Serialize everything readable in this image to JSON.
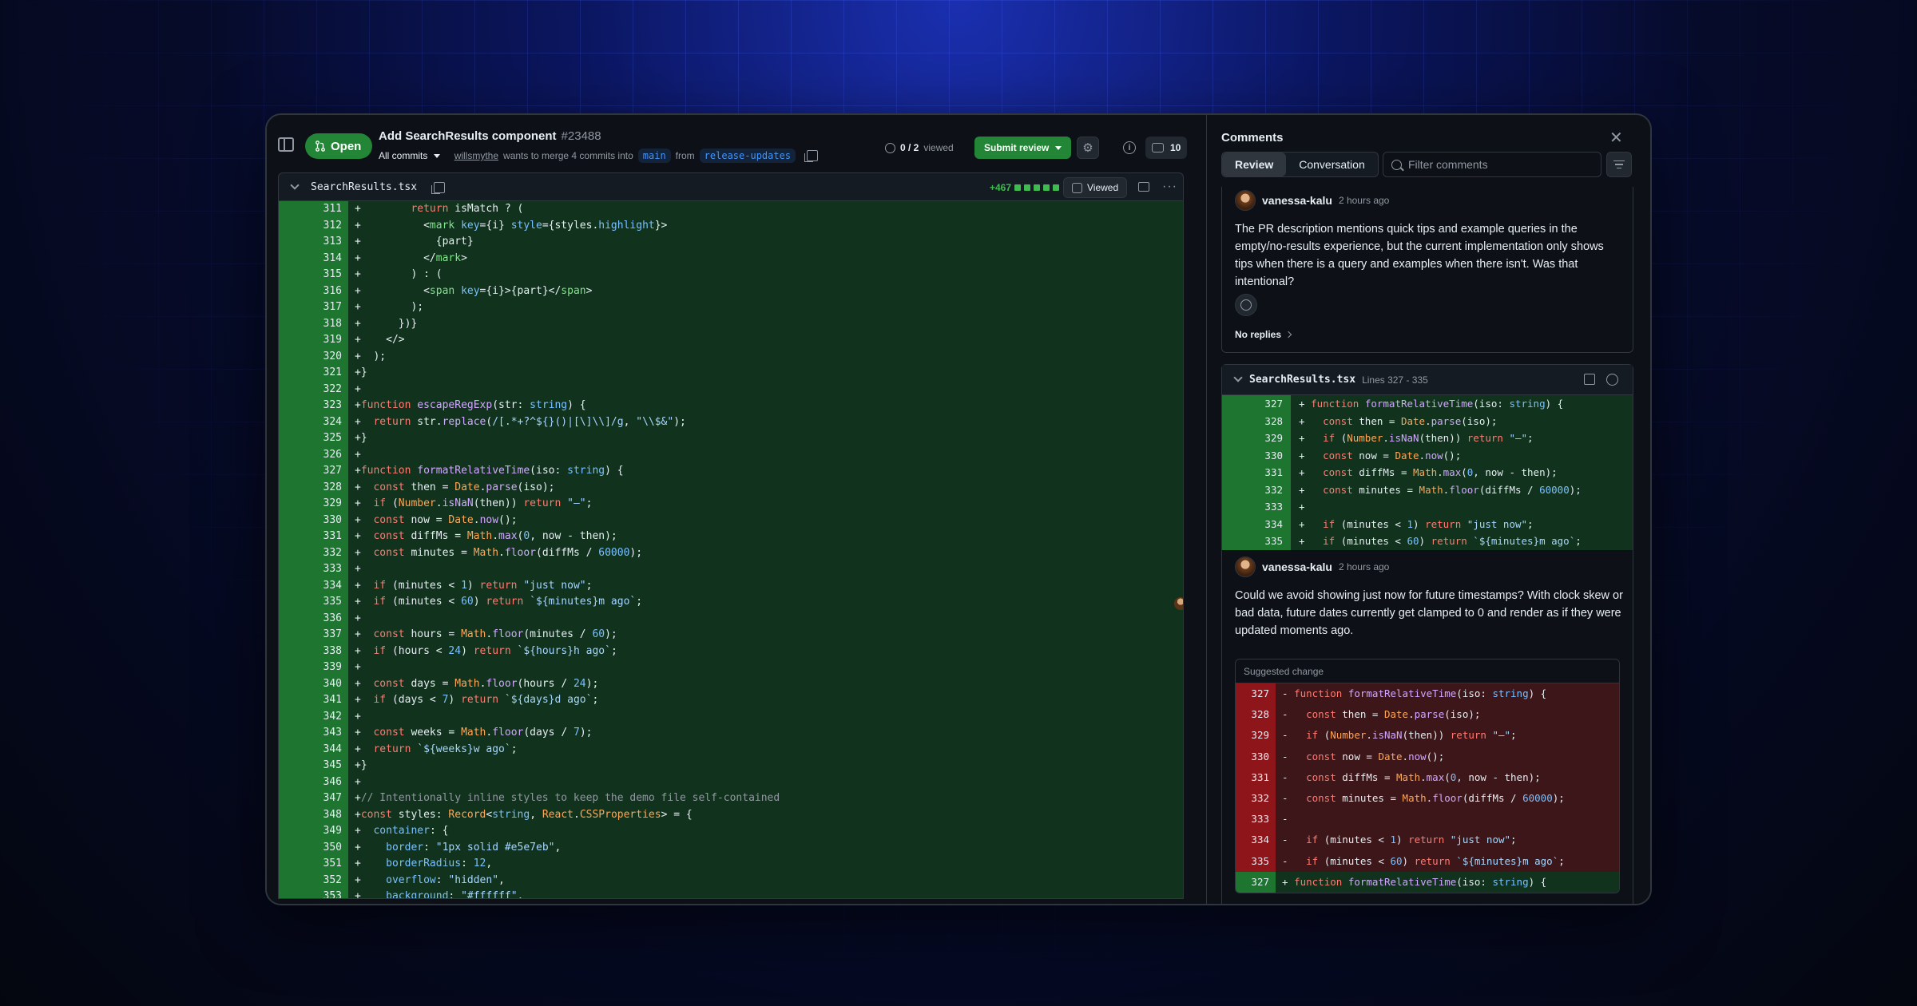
{
  "pr": {
    "status": "Open",
    "title": "Add SearchResults component",
    "number": "#23488",
    "commits_label": "All commits",
    "author": "willsmythe",
    "merge_text": "wants to merge 4 commits into",
    "base_branch": "main",
    "from_text": "from",
    "head_branch": "release-updates",
    "viewed_done": "0 / 2",
    "viewed_label": "viewed",
    "submit_label": "Submit review",
    "comment_count": "10"
  },
  "file": {
    "name": "SearchResults.tsx",
    "additions": "+467",
    "viewed_label": "Viewed"
  },
  "code_lines": [
    {
      "n": "311",
      "html": "+        <span class=\"k\">return</span> isMatch ? ("
    },
    {
      "n": "312",
      "html": "+          &lt;<span class=\"g\">mark</span> <span class=\"v\">key</span>={i} <span class=\"v\">style</span>={styles.<span class=\"v\">highlight</span>}&gt;"
    },
    {
      "n": "313",
      "html": "+            {part}"
    },
    {
      "n": "314",
      "html": "+          &lt;/<span class=\"g\">mark</span>&gt;"
    },
    {
      "n": "315",
      "html": "+        ) : ("
    },
    {
      "n": "316",
      "html": "+          &lt;<span class=\"g\">span</span> <span class=\"v\">key</span>={i}&gt;{part}&lt;/<span class=\"g\">span</span>&gt;"
    },
    {
      "n": "317",
      "html": "+        );"
    },
    {
      "n": "318",
      "html": "+      })}"
    },
    {
      "n": "319",
      "html": "+    &lt;/&gt;"
    },
    {
      "n": "320",
      "html": "+  );"
    },
    {
      "n": "321",
      "html": "+}"
    },
    {
      "n": "322",
      "html": "+"
    },
    {
      "n": "323",
      "html": "+<span class=\"k\">function</span> <span class=\"f\">escapeRegExp</span>(str: <span class=\"v\">string</span>) {"
    },
    {
      "n": "324",
      "html": "+  <span class=\"k\">return</span> str.<span class=\"f\">replace</span>(<span class=\"s\">/[.*+?^${}()|[\\]\\\\]/g</span>, <span class=\"s\">\"\\\\$&amp;\"</span>);"
    },
    {
      "n": "325",
      "html": "+}"
    },
    {
      "n": "326",
      "html": "+"
    },
    {
      "n": "327",
      "html": "+<span class=\"k\">function</span> <span class=\"f\">formatRelativeTime</span>(iso: <span class=\"v\">string</span>) {"
    },
    {
      "n": "328",
      "html": "+  <span class=\"k\">const</span> then = <span class=\"t\">Date</span>.<span class=\"f\">parse</span>(iso);"
    },
    {
      "n": "329",
      "html": "+  <span class=\"k\">if</span> (<span class=\"t\">Number</span>.<span class=\"f\">isNaN</span>(then)) <span class=\"k\">return</span> <span class=\"s\">\"—\"</span>;"
    },
    {
      "n": "330",
      "html": "+  <span class=\"k\">const</span> now = <span class=\"t\">Date</span>.<span class=\"f\">now</span>();"
    },
    {
      "n": "331",
      "html": "+  <span class=\"k\">const</span> diffMs = <span class=\"t\">Math</span>.<span class=\"f\">max</span>(<span class=\"v\">0</span>, now - then);"
    },
    {
      "n": "332",
      "html": "+  <span class=\"k\">const</span> minutes = <span class=\"t\">Math</span>.<span class=\"f\">floor</span>(diffMs / <span class=\"v\">60000</span>);"
    },
    {
      "n": "333",
      "html": "+"
    },
    {
      "n": "334",
      "html": "+  <span class=\"k\">if</span> (minutes &lt; <span class=\"v\">1</span>) <span class=\"k\">return</span> <span class=\"s\">\"just now\"</span>;"
    },
    {
      "n": "335",
      "html": "+  <span class=\"k\">if</span> (minutes &lt; <span class=\"v\">60</span>) <span class=\"k\">return</span> <span class=\"s\">`${minutes}m ago`</span>;",
      "comments": "1"
    },
    {
      "n": "336",
      "html": "+"
    },
    {
      "n": "337",
      "html": "+  <span class=\"k\">const</span> hours = <span class=\"t\">Math</span>.<span class=\"f\">floor</span>(minutes / <span class=\"v\">60</span>);"
    },
    {
      "n": "338",
      "html": "+  <span class=\"k\">if</span> (hours &lt; <span class=\"v\">24</span>) <span class=\"k\">return</span> <span class=\"s\">`${hours}h ago`</span>;"
    },
    {
      "n": "339",
      "html": "+"
    },
    {
      "n": "340",
      "html": "+  <span class=\"k\">const</span> days = <span class=\"t\">Math</span>.<span class=\"f\">floor</span>(hours / <span class=\"v\">24</span>);"
    },
    {
      "n": "341",
      "html": "+  <span class=\"k\">if</span> (days &lt; <span class=\"v\">7</span>) <span class=\"k\">return</span> <span class=\"s\">`${days}d ago`</span>;"
    },
    {
      "n": "342",
      "html": "+"
    },
    {
      "n": "343",
      "html": "+  <span class=\"k\">const</span> weeks = <span class=\"t\">Math</span>.<span class=\"f\">floor</span>(days / <span class=\"v\">7</span>);"
    },
    {
      "n": "344",
      "html": "+  <span class=\"k\">return</span> <span class=\"s\">`${weeks}w ago`</span>;"
    },
    {
      "n": "345",
      "html": "+}"
    },
    {
      "n": "346",
      "html": "+"
    },
    {
      "n": "347",
      "html": "+<span class=\"cm\">// Intentionally inline styles to keep the demo file self-contained</span>"
    },
    {
      "n": "348",
      "html": "+<span class=\"k\">const</span> styles: <span class=\"t\">Record</span>&lt;<span class=\"v\">string</span>, <span class=\"t\">React</span>.<span class=\"t\">CSSProperties</span>&gt; = {"
    },
    {
      "n": "349",
      "html": "+  <span class=\"v\">container</span>: {"
    },
    {
      "n": "350",
      "html": "+    <span class=\"v\">border</span>: <span class=\"s\">\"1px solid #e5e7eb\"</span>,"
    },
    {
      "n": "351",
      "html": "+    <span class=\"v\">borderRadius</span>: <span class=\"v\">12</span>,"
    },
    {
      "n": "352",
      "html": "+    <span class=\"v\">overflow</span>: <span class=\"s\">\"hidden\"</span>,"
    },
    {
      "n": "353",
      "html": "+    <span class=\"v\">background</span>: <span class=\"s\">\"#ffffff\"</span>,"
    }
  ],
  "comments_panel": {
    "title": "Comments",
    "tab_review": "Review",
    "tab_conversation": "Conversation",
    "filter_placeholder": "Filter comments",
    "comment1": {
      "author": "vanessa-kalu",
      "time": "2 hours ago",
      "body": "The PR description mentions quick tips and example queries in the empty/no-results experience, but the current implementation only shows tips when there is a query and examples when there isn't. Was that intentional?",
      "replies": "No replies"
    },
    "thread": {
      "file": "SearchResults.tsx",
      "lines": "Lines 327 - 335",
      "snippet": [
        {
          "n": "327",
          "html": "+ <span class=\"k\">function</span> <span class=\"f\">formatRelativeTime</span>(iso: <span class=\"v\">string</span>) {"
        },
        {
          "n": "328",
          "html": "+   <span class=\"k\">const</span> then = <span class=\"t\">Date</span>.<span class=\"f\">parse</span>(iso);"
        },
        {
          "n": "329",
          "html": "+   <span class=\"k\">if</span> (<span class=\"t\">Number</span>.<span class=\"f\">isNaN</span>(then)) <span class=\"k\">return</span> <span class=\"s\">\"—\"</span>;"
        },
        {
          "n": "330",
          "html": "+   <span class=\"k\">const</span> now = <span class=\"t\">Date</span>.<span class=\"f\">now</span>();"
        },
        {
          "n": "331",
          "html": "+   <span class=\"k\">const</span> diffMs = <span class=\"t\">Math</span>.<span class=\"f\">max</span>(<span class=\"v\">0</span>, now - then);"
        },
        {
          "n": "332",
          "html": "+   <span class=\"k\">const</span> minutes = <span class=\"t\">Math</span>.<span class=\"f\">floor</span>(diffMs / <span class=\"v\">60000</span>);"
        },
        {
          "n": "333",
          "html": "+"
        },
        {
          "n": "334",
          "html": "+   <span class=\"k\">if</span> (minutes &lt; <span class=\"v\">1</span>) <span class=\"k\">return</span> <span class=\"s\">\"just now\"</span>;"
        },
        {
          "n": "335",
          "html": "+   <span class=\"k\">if</span> (minutes &lt; <span class=\"v\">60</span>) <span class=\"k\">return</span> <span class=\"s\">`${minutes}m ago`</span>;"
        }
      ],
      "comment": {
        "author": "vanessa-kalu",
        "time": "2 hours ago",
        "body": "Could we avoid showing just now for future timestamps? With clock skew or bad data, future dates currently get clamped to 0 and render as if they were updated moments ago."
      },
      "suggested_label": "Suggested change",
      "suggested_lines": [
        {
          "n": "327",
          "type": "del",
          "html": "- <span class=\"k\">function</span> <span class=\"f\">formatRelativeTime</span>(iso: <span class=\"v\">string</span>) {"
        },
        {
          "n": "328",
          "type": "del",
          "html": "-   <span class=\"k\">const</span> then = <span class=\"t\">Date</span>.<span class=\"f\">parse</span>(iso);"
        },
        {
          "n": "329",
          "type": "del",
          "html": "-   <span class=\"k\">if</span> (<span class=\"t\">Number</span>.<span class=\"f\">isNaN</span>(then)) <span class=\"k\">return</span> <span class=\"s\">\"—\"</span>;"
        },
        {
          "n": "330",
          "type": "del",
          "html": "-   <span class=\"k\">const</span> now = <span class=\"t\">Date</span>.<span class=\"f\">now</span>();"
        },
        {
          "n": "331",
          "type": "del",
          "html": "-   <span class=\"k\">const</span> diffMs = <span class=\"t\">Math</span>.<span class=\"f\">max</span>(<span class=\"v\">0</span>, now - then);"
        },
        {
          "n": "332",
          "type": "del",
          "html": "-   <span class=\"k\">const</span> minutes = <span class=\"t\">Math</span>.<span class=\"f\">floor</span>(diffMs / <span class=\"v\">60000</span>);"
        },
        {
          "n": "333",
          "type": "del",
          "html": "-"
        },
        {
          "n": "334",
          "type": "del",
          "html": "-   <span class=\"k\">if</span> (minutes &lt; <span class=\"v\">1</span>) <span class=\"k\">return</span> <span class=\"s\">\"just now\"</span>;"
        },
        {
          "n": "335",
          "type": "del",
          "html": "-   <span class=\"k\">if</span> (minutes &lt; <span class=\"v\">60</span>) <span class=\"k\">return</span> <span class=\"s\">`${minutes}m ago`</span>;"
        },
        {
          "n": "327",
          "type": "add",
          "html": "+ <span class=\"k\">function</span> <span class=\"f\">formatRelativeTime</span>(iso: <span class=\"v\">string</span>) {"
        }
      ]
    }
  },
  "colors": {
    "accent_green": "#238636",
    "add_line_bg": "#11331d",
    "del_line_bg": "#3c1618",
    "link_blue": "#4493f8"
  },
  "icons": [
    "sidebar-toggle-icon",
    "git-pull-request-icon",
    "copy-icon",
    "circle-icon",
    "gear-icon",
    "info-icon",
    "comment-icon",
    "chevron-down-icon",
    "kebab-icon",
    "close-icon",
    "search-icon",
    "filter-icon",
    "smiley-icon",
    "chevron-right-icon",
    "check-circle-icon"
  ]
}
